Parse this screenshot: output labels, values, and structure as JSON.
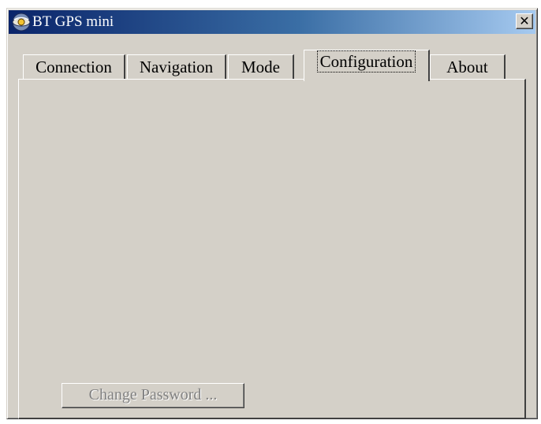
{
  "window": {
    "title": "BT GPS mini",
    "close_glyph": "✕",
    "app_icon": "gps-globe-icon"
  },
  "tabs": [
    {
      "label": "Connection",
      "active": false
    },
    {
      "label": "Navigation",
      "active": false
    },
    {
      "label": "Mode",
      "active": false
    },
    {
      "label": "Configuration",
      "active": true
    },
    {
      "label": "About",
      "active": false
    }
  ],
  "panel": {
    "change_password_label": "Change Password ...",
    "change_password_enabled": false
  }
}
